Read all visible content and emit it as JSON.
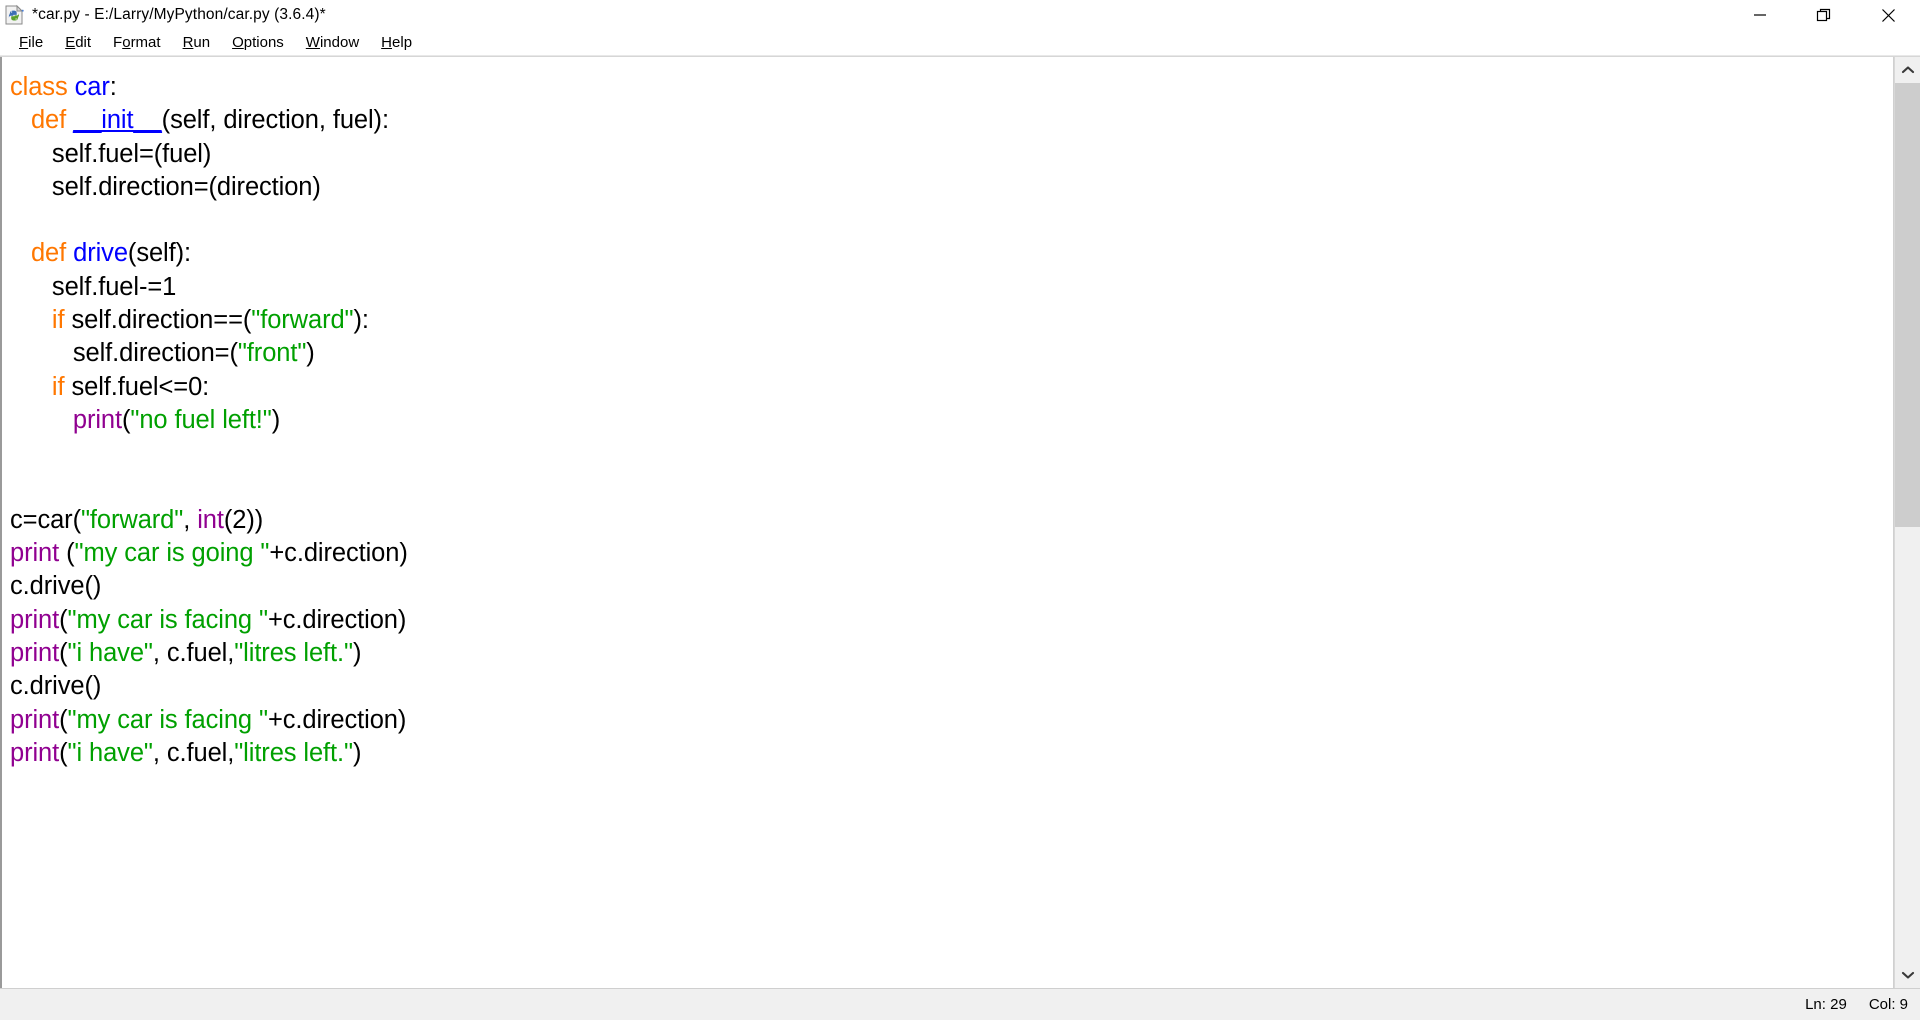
{
  "window": {
    "title": "*car.py - E:/Larry/MyPython/car.py (3.6.4)*",
    "icon": "python-file-icon",
    "controls": {
      "minimize": "minimize-icon",
      "restore": "restore-icon",
      "close": "close-icon"
    }
  },
  "menubar": {
    "items": [
      {
        "label": "File",
        "accel": "F"
      },
      {
        "label": "Edit",
        "accel": "E"
      },
      {
        "label": "Format",
        "accel": "o"
      },
      {
        "label": "Run",
        "accel": "R"
      },
      {
        "label": "Options",
        "accel": "O"
      },
      {
        "label": "Window",
        "accel": "W"
      },
      {
        "label": "Help",
        "accel": "H"
      }
    ]
  },
  "editor": {
    "filename": "car.py",
    "language": "Python",
    "modified": true,
    "code_lines": [
      "class car:",
      "   def __init__(self, direction, fuel):",
      "      self.fuel=(fuel)",
      "      self.direction=(direction)",
      "",
      "   def drive(self):",
      "      self.fuel-=1",
      "      if self.direction==(\"forward\"):",
      "         self.direction=(\"front\")",
      "      if self.fuel<=0:",
      "         print(\"no fuel left!\")",
      "",
      "",
      "c=car(\"forward\", int(2))",
      "print (\"my car is going \"+c.direction)",
      "c.drive()",
      "print(\"my car is facing \"+c.direction)",
      "print(\"i have\", c.fuel,\"litres left.\")",
      "c.drive()",
      "print(\"my car is facing \"+c.direction)",
      "print(\"i have\", c.fuel,\"litres left.\")"
    ],
    "syntax_colors": {
      "keyword": "#ff7700",
      "definition": "#0000ff",
      "string": "#00a000",
      "builtin": "#900090",
      "plain": "#000000",
      "background": "#ffffff"
    }
  },
  "scrollbar": {
    "up_arrow": "chevron-up-icon",
    "down_arrow": "chevron-down-icon",
    "thumb_top_percent": 0,
    "thumb_height_percent": 50.5
  },
  "statusbar": {
    "line_label": "Ln: 29",
    "column_label": "Col: 9"
  }
}
